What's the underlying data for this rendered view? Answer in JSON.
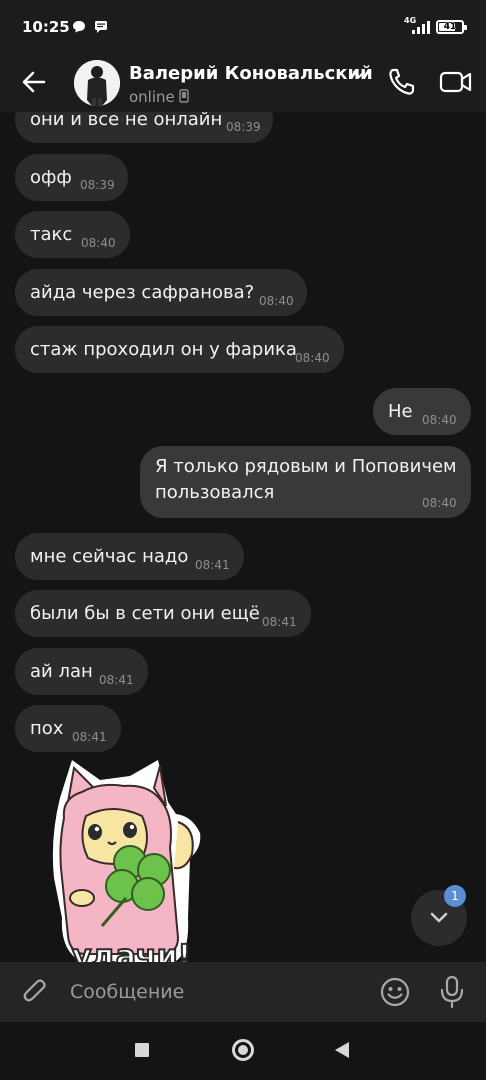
{
  "status_bar": {
    "time": "10:25",
    "network": "4G",
    "battery": "41"
  },
  "header": {
    "contact_name": "Валерий Коновальский",
    "status": "online",
    "icons": [
      "back-arrow-icon",
      "chevron-down-icon",
      "mobile-phone-icon",
      "phone-call-icon",
      "video-camera-icon"
    ]
  },
  "messages": [
    {
      "dir": "in",
      "text": "они и все не онлайн",
      "time": "08:39"
    },
    {
      "dir": "in",
      "text": "офф",
      "time": "08:39"
    },
    {
      "dir": "in",
      "text": "такс",
      "time": "08:40"
    },
    {
      "dir": "in",
      "text": "айда через сафранова?",
      "time": "08:40"
    },
    {
      "dir": "in",
      "text": "стаж проходил он у фарика",
      "time": "08:40"
    },
    {
      "dir": "out",
      "text": "Не",
      "time": "08:40"
    },
    {
      "dir": "out",
      "text": "Я только рядовым и Поповичем пользовался",
      "time": "08:40"
    },
    {
      "dir": "in",
      "text": "мне сейчас надо",
      "time": "08:41"
    },
    {
      "dir": "in",
      "text": "были бы в сети они ещё",
      "time": "08:41"
    },
    {
      "dir": "in",
      "text": "ай лан",
      "time": "08:41"
    },
    {
      "dir": "in",
      "text": "пох",
      "time": "08:41"
    }
  ],
  "sticker": {
    "caption": "удачи!",
    "colors": {
      "body": "#f4b6c4",
      "face": "#f7e6a3",
      "clover": "#6cc24a"
    }
  },
  "scroll_down": {
    "badge": "1",
    "icon": "chevron-down-icon"
  },
  "composer": {
    "placeholder": "Сообщение",
    "value": "",
    "icons": [
      "paperclip-icon",
      "emoji-icon",
      "microphone-icon"
    ]
  },
  "colors": {
    "background": "#141414",
    "bubble_in": "#2c2c2c",
    "bubble_out": "#393939",
    "badge": "#5a8fd3"
  }
}
